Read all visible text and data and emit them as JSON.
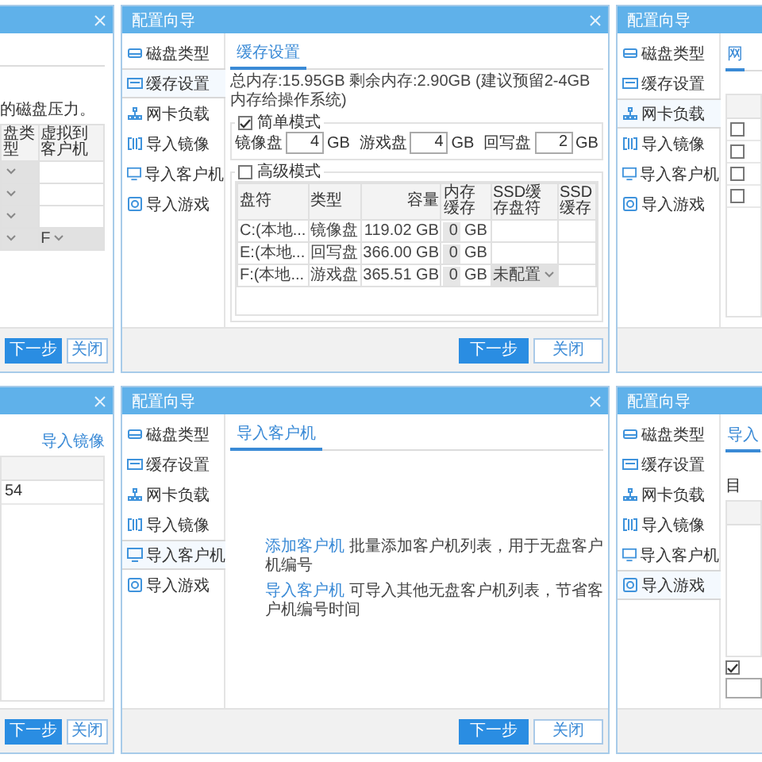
{
  "windows": [
    {
      "kind": "disk_slice",
      "hint": "的磁盘压力。",
      "columns": [
        "盘类型",
        "虚拟到客户机"
      ],
      "rows": [
        {
          "kind": "empty"
        },
        {
          "kind": "empty"
        },
        {
          "kind": "empty"
        },
        {
          "kind": "select",
          "target": "F"
        }
      ],
      "buttons": [
        {
          "label": "下一步",
          "kind": "primary"
        },
        {
          "label": "关闭",
          "kind": "secondary"
        }
      ]
    },
    {
      "kind": "cache_settings",
      "title": "配置向导",
      "sidebar": [
        {
          "label": "磁盘类型",
          "selected": false
        },
        {
          "label": "缓存设置",
          "selected": true
        },
        {
          "label": "网卡负载",
          "selected": false
        },
        {
          "label": "导入镜像",
          "selected": false
        },
        {
          "label": "导入客户机",
          "selected": false
        },
        {
          "label": "导入游戏",
          "selected": false
        }
      ],
      "tab": "缓存设置",
      "memory_info": "总内存:15.95GB 剩余内存:2.90GB (建议预留2-4GB内存给操作系统)",
      "simple_mode": {
        "label": "简单模式",
        "checked": true,
        "fields": [
          {
            "label": "镜像盘",
            "value": "4",
            "unit": "GB"
          },
          {
            "label": "游戏盘",
            "value": "4",
            "unit": "GB"
          },
          {
            "label": "回写盘",
            "value": "2",
            "unit": "GB"
          }
        ]
      },
      "advanced_mode": {
        "label": "高级模式",
        "checked": false
      },
      "table": {
        "columns": [
          "盘符",
          "类型",
          "容量",
          "内存缓存",
          "SSD缓存盘符",
          "SSD缓存"
        ],
        "rows": [
          {
            "drive": "C:(本地...",
            "type": "镜像盘",
            "capacity": "119.02 GB",
            "memory_cache": "0",
            "unit": "GB"
          },
          {
            "drive": "E:(本地...",
            "type": "回写盘",
            "capacity": "366.00 GB",
            "memory_cache": "0",
            "unit": "GB"
          },
          {
            "drive": "F:(本地...",
            "type": "游戏盘",
            "capacity": "365.51 GB",
            "memory_cache": "0",
            "unit": "GB",
            "ssd_drive": "未配置"
          }
        ]
      },
      "buttons": [
        {
          "label": "下一步",
          "kind": "primary"
        },
        {
          "label": "关闭",
          "kind": "secondary"
        }
      ]
    },
    {
      "kind": "nic_slice",
      "title": "配置向导",
      "sidebar": [
        {
          "label": "磁盘类型",
          "selected": false
        },
        {
          "label": "缓存设置",
          "selected": false
        },
        {
          "label": "网卡负载",
          "selected": true
        },
        {
          "label": "导入镜像",
          "selected": false
        },
        {
          "label": "导入客户机",
          "selected": false
        },
        {
          "label": "导入游戏",
          "selected": false
        }
      ],
      "tab": "网",
      "rows": [
        {
          "checked": false
        },
        {
          "checked": false
        },
        {
          "checked": false
        },
        {
          "checked": false
        }
      ]
    },
    {
      "kind": "image_slice",
      "link": "导入镜像",
      "rows": [
        {
          "cell": "54"
        }
      ],
      "buttons": [
        {
          "label": "下一步",
          "kind": "primary"
        },
        {
          "label": "关闭",
          "kind": "secondary"
        }
      ]
    },
    {
      "kind": "client_import",
      "title": "配置向导",
      "sidebar": [
        {
          "label": "磁盘类型",
          "selected": false
        },
        {
          "label": "缓存设置",
          "selected": false
        },
        {
          "label": "网卡负载",
          "selected": false
        },
        {
          "label": "导入镜像",
          "selected": false
        },
        {
          "label": "导入客户机",
          "selected": true
        },
        {
          "label": "导入游戏",
          "selected": false
        }
      ],
      "tab": "导入客户机",
      "lines": [
        {
          "link": "添加客户机",
          "text": "批量添加客户机列表，用于无盘客户机编号"
        },
        {
          "link": "导入客户机",
          "text": "可导入其他无盘客户机列表，节省客户机编号时间"
        }
      ],
      "buttons": [
        {
          "label": "下一步",
          "kind": "primary"
        },
        {
          "label": "关闭",
          "kind": "secondary"
        }
      ]
    },
    {
      "kind": "game_slice",
      "title": "配置向导",
      "sidebar": [
        {
          "label": "磁盘类型",
          "selected": false
        },
        {
          "label": "缓存设置",
          "selected": false
        },
        {
          "label": "网卡负载",
          "selected": false
        },
        {
          "label": "导入镜像",
          "selected": false
        },
        {
          "label": "导入客户机",
          "selected": false
        },
        {
          "label": "导入游戏",
          "selected": true
        }
      ],
      "tab": "导入",
      "label": "目",
      "option": {
        "checked": true
      }
    }
  ]
}
